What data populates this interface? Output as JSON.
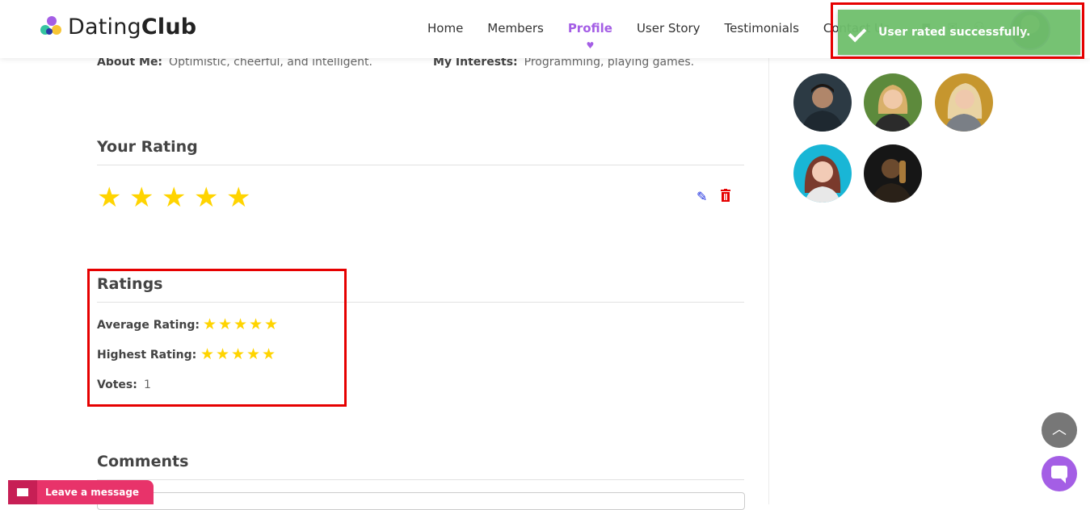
{
  "brand": {
    "name_light": "Dating",
    "name_bold": "Club"
  },
  "nav": {
    "items": [
      {
        "label": "Home"
      },
      {
        "label": "Members"
      },
      {
        "label": "Profile",
        "active": true
      },
      {
        "label": "User Story"
      },
      {
        "label": "Testimonials"
      },
      {
        "label": "Contact Us"
      }
    ]
  },
  "toast": {
    "message": "User rated successfully.",
    "color": "#6fbf6c"
  },
  "about": {
    "about_label": "About Me:",
    "about_value": "Optimistic, cheerful, and intelligent.",
    "interests_label": "My Interests:",
    "interests_value": "Programming, playing games."
  },
  "your_rating": {
    "title": "Your Rating",
    "stars": 5,
    "max": 5
  },
  "ratings": {
    "title": "Ratings",
    "average_label": "Average Rating:",
    "average_stars": 5,
    "highest_label": "Highest Rating:",
    "highest_stars": 5,
    "votes_label": "Votes:",
    "votes_value": "1"
  },
  "comments": {
    "title": "Comments"
  },
  "chat": {
    "leave_message": "Leave a message"
  },
  "colors": {
    "accent": "#a45ee5",
    "star": "#ffd400",
    "highlight": "#e60000",
    "leave_message": "#e8336a"
  }
}
